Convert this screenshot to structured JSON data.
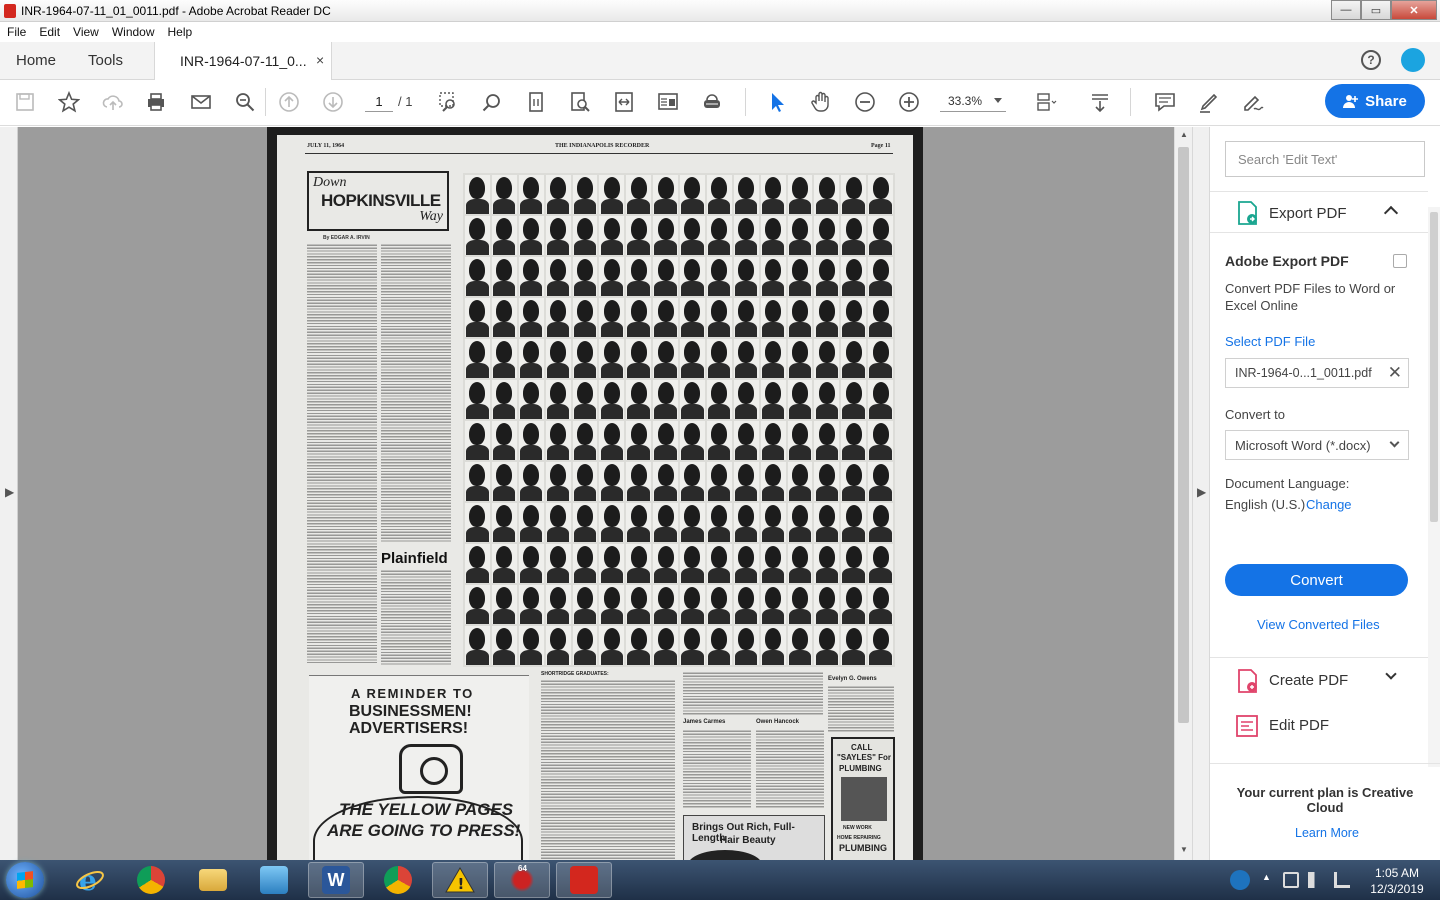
{
  "window": {
    "title": "INR-1964-07-11_01_0011.pdf - Adobe Acrobat Reader DC",
    "minimize": "—",
    "maximize": "▭",
    "close": "✕"
  },
  "menu": [
    "File",
    "Edit",
    "View",
    "Window",
    "Help"
  ],
  "tabs": {
    "home": "Home",
    "tools": "Tools",
    "document": "INR-1964-07-11_0...",
    "close": "×"
  },
  "toolbar": {
    "page_current": "1",
    "page_total": "/ 1",
    "zoom": "33.3%",
    "share_label": "Share"
  },
  "document": {
    "header_left": "JULY 11, 1964",
    "header_center": "THE INDIANAPOLIS RECORDER",
    "header_right": "Page 11",
    "masthead_down": "Down",
    "masthead_main": "HOPKINSVILLE",
    "masthead_way": "Way",
    "byline": "By EDGAR A. IRVIN",
    "plainfield": "Plainfield",
    "ad_line1": "A REMINDER TO",
    "ad_line2": "BUSINESSMEN!",
    "ad_line3": "ADVERTISERS!",
    "ad_line4": "THE YELLOW PAGES",
    "ad_line5": "ARE GOING TO PRESS!",
    "caption_title": "SHORTRIDGE GRADUATES:",
    "obit_owens": "Evelyn G. Owens",
    "obit_carmes": "James Carmes",
    "obit_hancock": "Owen Hancock",
    "hair_ad_line1": "Brings Out Rich, Full-Length",
    "hair_ad_line2": "Hair Beauty",
    "plumb_call": "CALL",
    "plumb_sayles": "\"SAYLES\" For",
    "plumb_plumbing": "PLUMBING",
    "plumb_new_work": "NEW WORK",
    "plumb_repair": "HOME REPAIRING",
    "plumb_plumbing2": "PLUMBING"
  },
  "right_pane": {
    "search_placeholder": "Search 'Edit Text'",
    "export_label": "Export PDF",
    "adobe_export_title": "Adobe Export PDF",
    "adobe_export_desc": "Convert PDF Files to Word or Excel Online",
    "select_file_label": "Select PDF File",
    "selected_file": "INR-1964-0...1_0011.pdf",
    "convert_to_label": "Convert to",
    "convert_format": "Microsoft Word (*.docx)",
    "doc_language_label": "Document Language:",
    "doc_language_value": "English (U.S.)",
    "change_link": "Change",
    "convert_button": "Convert",
    "view_converted": "View Converted Files",
    "create_pdf": "Create PDF",
    "edit_pdf": "Edit PDF",
    "plan_text": "Your current plan is Creative Cloud",
    "learn_more": "Learn More"
  },
  "taskbar": {
    "time": "1:05 AM",
    "date": "12/3/2019",
    "badge_count": "64"
  },
  "colors": {
    "accent_blue": "#1473e6",
    "acrobat_red": "#d3271e",
    "taskbar": "#2a3e58"
  }
}
